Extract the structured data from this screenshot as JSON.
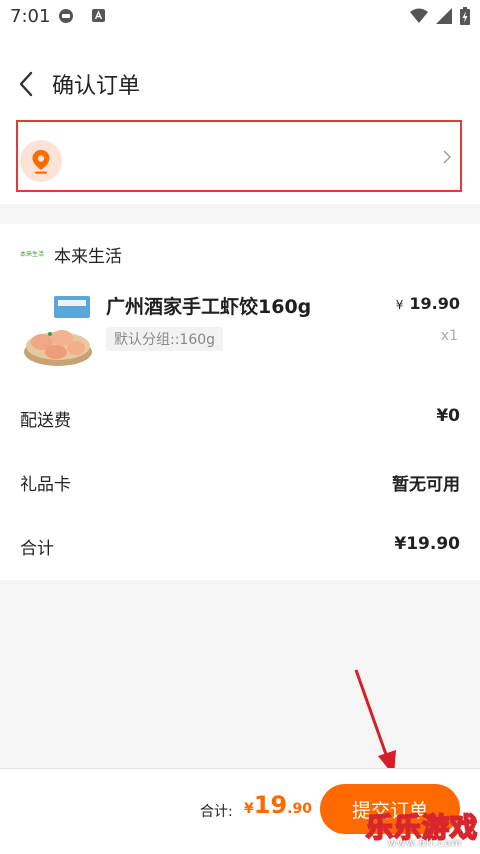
{
  "status_bar": {
    "time": "7:01",
    "icons": [
      "game-controller-icon",
      "a-box-icon",
      "wifi-icon",
      "signal-icon",
      "battery-charging-icon"
    ]
  },
  "header": {
    "title": "确认订单",
    "back_icon": "chevron-left-icon"
  },
  "address": {
    "icon": "location-pin-icon",
    "chevron_icon": "chevron-right-icon",
    "highlight_color": "#e53935"
  },
  "store": {
    "logo_text": "本来生活",
    "name": "本来生活"
  },
  "product": {
    "name": "广州酒家手工虾饺160g",
    "spec": "默认分组::160g",
    "currency": "¥",
    "price": "19.90",
    "quantity": "x1"
  },
  "rows": {
    "delivery_label": "配送费",
    "delivery_value": "¥0",
    "giftcard_label": "礼品卡",
    "giftcard_value": "暂无可用",
    "subtotal_label": "合计",
    "subtotal_value": "¥19.90"
  },
  "footer": {
    "total_label": "合计:",
    "total_currency": "¥",
    "total_integer": "19",
    "total_decimal": ".90",
    "submit_label": "提交订单"
  },
  "watermark": {
    "text": "乐乐游戏",
    "url": "www.6ll.com"
  },
  "colors": {
    "accent": "#ff6a00",
    "background": "#f5f5f5"
  }
}
